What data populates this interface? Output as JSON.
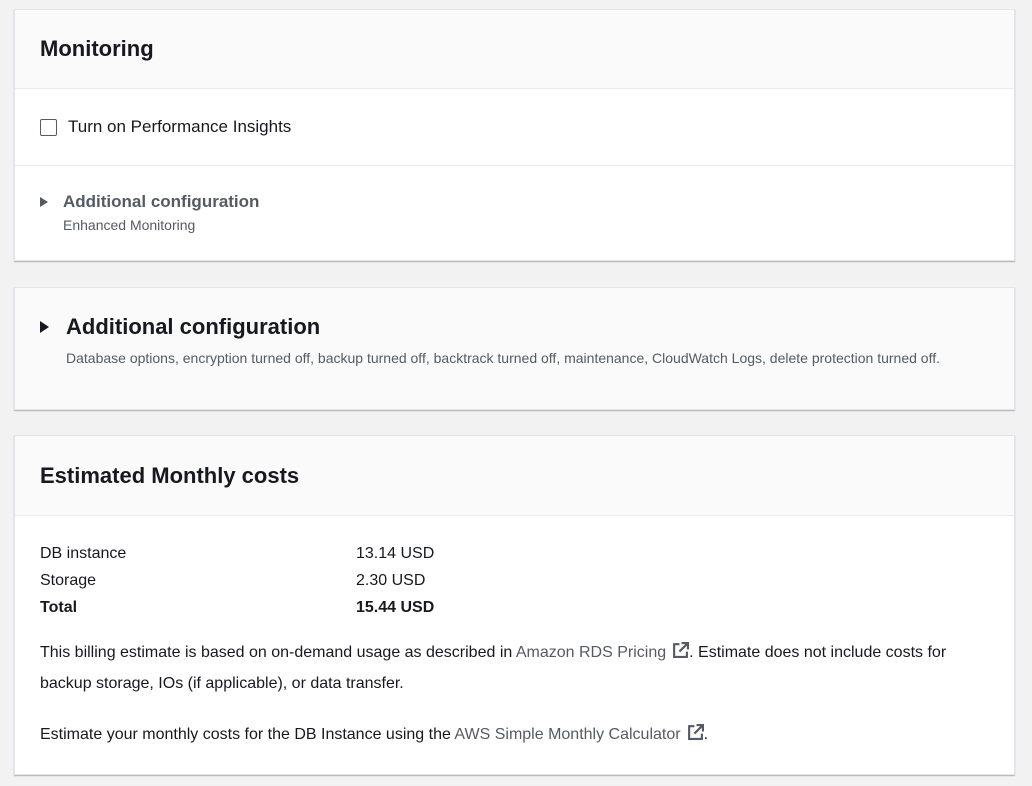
{
  "monitoring": {
    "title": "Monitoring",
    "performance_insights_label": "Turn on Performance Insights",
    "performance_insights_checked": false,
    "additional_config_title": "Additional configuration",
    "additional_config_desc": "Enhanced Monitoring"
  },
  "additional_configuration": {
    "title": "Additional configuration",
    "description": "Database options, encryption turned off, backup turned off, backtrack turned off, maintenance, CloudWatch Logs, delete protection turned off."
  },
  "costs": {
    "title": "Estimated Monthly costs",
    "rows": [
      {
        "name": "DB instance",
        "value": "13.14 USD"
      },
      {
        "name": "Storage",
        "value": "2.30 USD"
      },
      {
        "name": "Total",
        "value": "15.44 USD"
      }
    ],
    "billing_text_before": "This billing estimate is based on on-demand usage as described in ",
    "billing_link": "Amazon RDS Pricing",
    "billing_text_after": ". Estimate does not include costs for backup storage, IOs (if applicable), or data transfer.",
    "calc_text_before": "Estimate your monthly costs for the DB Instance using the ",
    "calc_link": "AWS Simple Monthly Calculator",
    "calc_text_after": "."
  },
  "icons": {
    "caret": "caret-right-icon",
    "external": "external-link-icon"
  },
  "colors": {
    "text": "#16191f",
    "secondary_text": "#545b64",
    "panel_header_bg": "#fafafa",
    "page_bg": "#f2f2f2"
  }
}
